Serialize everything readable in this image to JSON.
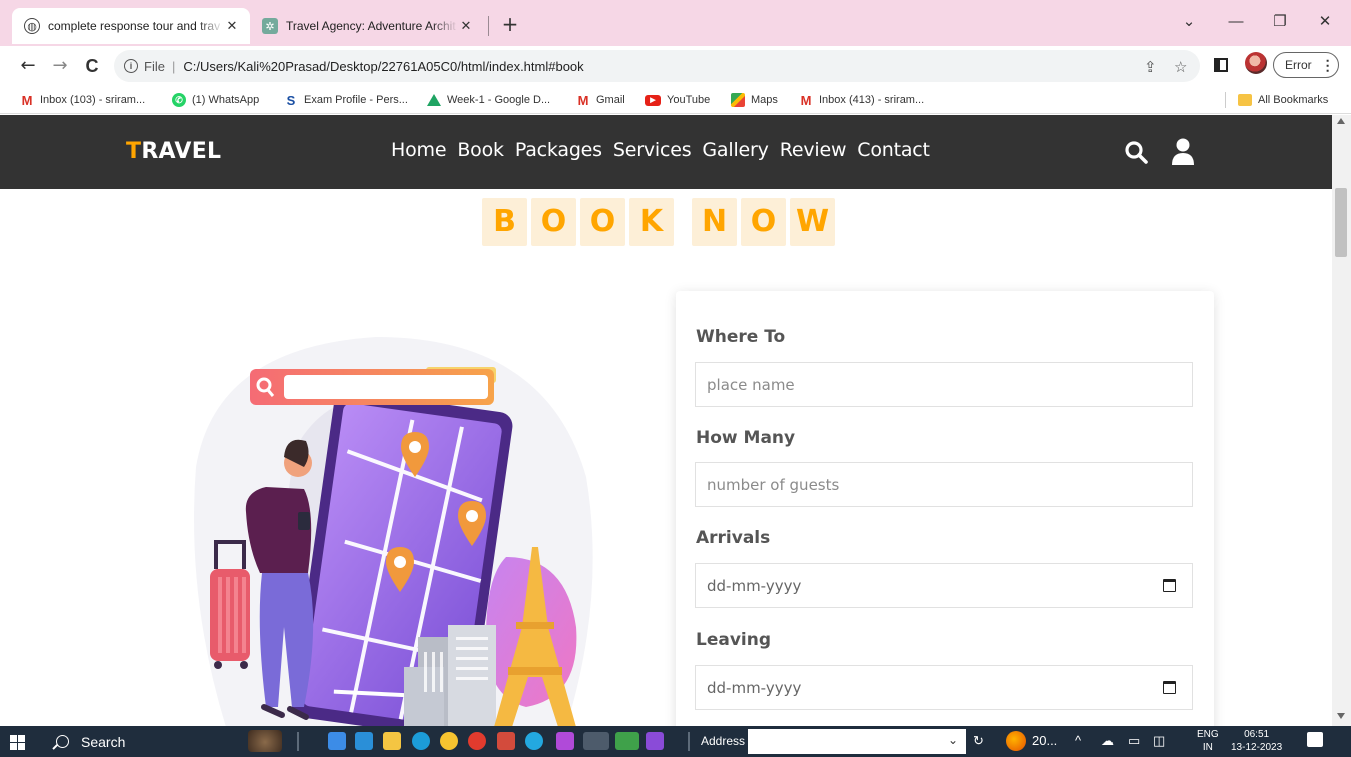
{
  "browser": {
    "tabs": [
      {
        "title": "complete response tour and trav",
        "active": true
      },
      {
        "title": "Travel Agency: Adventure Archit",
        "active": false
      }
    ],
    "new_tab": "+",
    "window_controls": {
      "minimize": "—",
      "restore": "❐",
      "close": "✕",
      "tab_search": "⌄"
    },
    "nav": {
      "back": "←",
      "forward": "→",
      "reload": "C"
    },
    "address": {
      "scheme": "File",
      "url": "C:/Users/Kali%20Prasad/Desktop/22761A05C0/html/index.html#book"
    },
    "error_chip": "Error",
    "bookmarks": [
      {
        "label": "Inbox (103) - sriram...",
        "icon": "gmail-icon"
      },
      {
        "label": "(1) WhatsApp",
        "icon": "whatsapp-icon"
      },
      {
        "label": "Exam Profile - Pers...",
        "icon": "exam-icon"
      },
      {
        "label": "Week-1 - Google D...",
        "icon": "google-drive-icon"
      },
      {
        "label": "Gmail",
        "icon": "gmail-icon"
      },
      {
        "label": "YouTube",
        "icon": "youtube-icon"
      },
      {
        "label": "Maps",
        "icon": "maps-icon"
      },
      {
        "label": "Inbox (413) - sriram...",
        "icon": "gmail-icon"
      }
    ],
    "all_bookmarks": "All Bookmarks"
  },
  "site": {
    "logo_first": "T",
    "logo_rest": "RAVEL",
    "nav": [
      "Home",
      "Book",
      "Packages",
      "Services",
      "Gallery",
      "Review",
      "Contact"
    ],
    "heading_word1": [
      "B",
      "O",
      "O",
      "K"
    ],
    "heading_word2": [
      "N",
      "O",
      "W"
    ],
    "form": {
      "where_label": "Where To",
      "where_placeholder": "place name",
      "how_many_label": "How Many",
      "how_many_placeholder": "number of guests",
      "arrivals_label": "Arrivals",
      "arrivals_value": "dd-mm-yyyy",
      "leaving_label": "Leaving",
      "leaving_value": "dd-mm-yyyy"
    },
    "colors": {
      "header_bg": "#333333",
      "accent": "#ffa500",
      "letter_bg": "#fdefd7"
    }
  },
  "taskbar": {
    "search": "Search",
    "address_label": "Address",
    "weather": "20...",
    "lang_top": "ENG",
    "lang_bottom": "IN",
    "time": "06:51",
    "date": "13-12-2023"
  }
}
